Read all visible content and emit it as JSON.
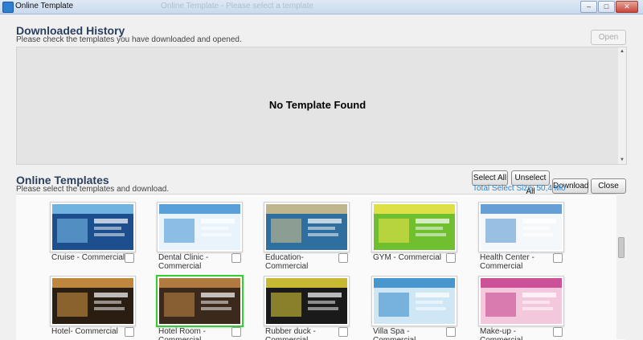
{
  "window": {
    "title": "Online Template",
    "ghost_title": "Online Template - Please select a template",
    "min_glyph": "–",
    "max_glyph": "□",
    "close_glyph": "✕"
  },
  "history": {
    "title": "Downloaded History",
    "subtitle": "Please check the templates you have downloaded and opened.",
    "open_label": "Open",
    "empty_text": "No Template Found",
    "scroll_up": "▲",
    "scroll_down": "▼"
  },
  "online": {
    "title": "Online Templates",
    "subtitle": "Please select the templates and download.",
    "select_all_label": "Select All",
    "unselect_all_label": "Unselect All",
    "download_label": "Download",
    "close_label": "Close",
    "total_size": "Total Select Size:  50,4 Mo"
  },
  "templates": [
    {
      "label": "Cruise - Commercial",
      "bg": "#1d4f8f",
      "accent": "#7fc3ef",
      "selected": false
    },
    {
      "label": "Dental Clinic - Commercial",
      "bg": "#e9f3fb",
      "accent": "#3f8fd3",
      "selected": false
    },
    {
      "label": "Education- Commercial",
      "bg": "#2f6f9f",
      "accent": "#d8c38a",
      "selected": false
    },
    {
      "label": "GYM - Commercial",
      "bg": "#6fbf2f",
      "accent": "#f2e64a",
      "selected": false
    },
    {
      "label": "Health Center - Commercial",
      "bg": "#f5f8fb",
      "accent": "#4c8fcf",
      "selected": false
    },
    {
      "label": "Hotel- Commercial",
      "bg": "#2a1d12",
      "accent": "#d99a45",
      "selected": false
    },
    {
      "label": "Hotel Room - Commercial",
      "bg": "#3b2a1c",
      "accent": "#c78a46",
      "selected": true
    },
    {
      "label": "Rubber duck - Commercial",
      "bg": "#1a1a1a",
      "accent": "#e8d53a",
      "selected": false
    },
    {
      "label": "Villa Spa - Commercial",
      "bg": "#cfe6f5",
      "accent": "#2f87c7",
      "selected": false
    },
    {
      "label": "Make-up - Commercial",
      "bg": "#f3c8dc",
      "accent": "#c43c8c",
      "selected": false
    }
  ]
}
